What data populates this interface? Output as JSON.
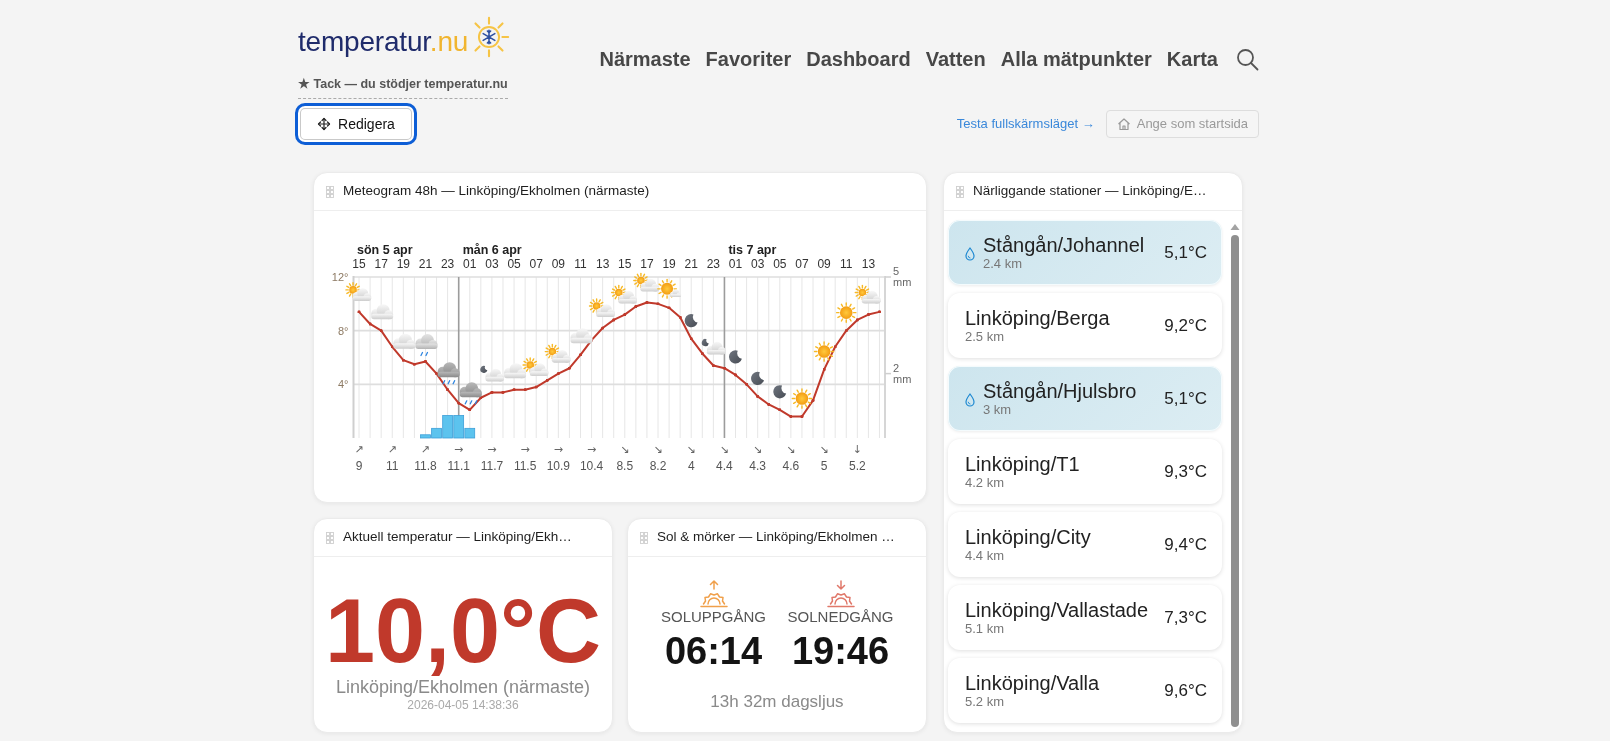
{
  "header": {
    "logo": {
      "name": "temperatur",
      "suffix": ".nu"
    },
    "thanks": "★ Tack — du stödjer temperatur.nu"
  },
  "nav": [
    {
      "label": "Närmaste",
      "selected": false
    },
    {
      "label": "Favoriter",
      "selected": false
    },
    {
      "label": "Dashboard",
      "selected": false
    },
    {
      "label": "Vatten",
      "selected": false
    },
    {
      "label": "Alla mätpunkter",
      "selected": false
    },
    {
      "label": "Karta",
      "selected": false
    }
  ],
  "toolbar": {
    "edit_button": {
      "label": "Redigera",
      "focused": true
    },
    "fullscreen_link": "Testa fullskärmsläget →",
    "start_button": {
      "label": "Ange som startsida",
      "disabled": true
    }
  },
  "meteogram": {
    "title": "Meteogram 48h — Linköping/Ekholmen (närmaste)",
    "temperature": {
      "chart_data": {
        "type": "line",
        "grid": true,
        "categories": [
          "15",
          null,
          "17",
          null,
          "19",
          null,
          "21",
          null,
          "23",
          null,
          "01",
          null,
          "03",
          null,
          "05",
          null,
          "07",
          null,
          "09",
          null,
          "11",
          null,
          "13",
          null,
          "15",
          null,
          "17",
          null,
          "19",
          null,
          "21",
          null,
          "23",
          null,
          "01",
          null,
          "03",
          null,
          "05",
          null,
          "07",
          null,
          "09",
          null,
          "11",
          null,
          "13",
          null
        ],
        "ylim": [
          0,
          12
        ],
        "yticks": [
          {
            "value": 4,
            "label": "4°"
          },
          {
            "value": 8,
            "label": "8°"
          },
          {
            "value": 12,
            "label": "12°"
          }
        ],
        "series": [
          {
            "color": "#c0392b",
            "values": [
              9.4,
              8.5,
              8.0,
              6.8,
              5.8,
              5.5,
              5.7,
              4.8,
              3.6,
              2.6,
              2.1,
              3.0,
              3.4,
              3.4,
              3.6,
              3.6,
              3.8,
              4.3,
              4.8,
              5.2,
              6.2,
              7.3,
              8.2,
              8.8,
              9.2,
              9.8,
              10.1,
              10.0,
              9.7,
              9.0,
              7.4,
              6.3,
              5.4,
              5.2,
              4.7,
              4.0,
              3.1,
              2.5,
              2.1,
              1.6,
              1.6,
              2.8,
              5.1,
              6.8,
              8.0,
              8.8,
              9.2,
              9.4
            ]
          }
        ],
        "annotations": [
          "sön 5 apr",
          "mån 6 apr",
          "tis 7 apr"
        ]
      }
    },
    "precipitation": {
      "chart_data": {
        "type": "bar",
        "categories": [
          null,
          null,
          null,
          null,
          null,
          null,
          null,
          null,
          null,
          null,
          null,
          null,
          null,
          null,
          null,
          null,
          null,
          null,
          null,
          null,
          null,
          null,
          null,
          null,
          null,
          null,
          null,
          null,
          null,
          null,
          null,
          null,
          null,
          null,
          null,
          null,
          null,
          null,
          null,
          null,
          null,
          null,
          null,
          null,
          null,
          null,
          null,
          null
        ],
        "ylim": [
          0,
          5
        ],
        "yticks": [
          {
            "value": 2,
            "label": "2 mm"
          },
          {
            "value": 5,
            "label": "5 mm"
          }
        ],
        "series": [
          {
            "color": "#5cc3ee",
            "values": [
              null,
              null,
              null,
              null,
              null,
              null,
              0.1,
              0.3,
              0.7,
              0.7,
              0.3,
              null,
              null,
              null,
              null,
              null,
              null,
              null,
              null,
              null,
              null,
              null,
              null,
              null,
              null,
              null,
              null,
              null,
              null,
              null,
              null,
              null,
              null,
              null,
              null,
              null,
              null,
              null,
              null,
              null,
              null,
              null,
              null,
              null,
              null,
              null,
              null,
              null
            ]
          }
        ]
      }
    },
    "wind": [
      {
        "arrow": "↗",
        "speed": "9"
      },
      {
        "arrow": "↗",
        "speed": "11"
      },
      {
        "arrow": "↗",
        "speed": "11.8"
      },
      {
        "arrow": "→",
        "speed": "11.1"
      },
      {
        "arrow": "→",
        "speed": "11.7"
      },
      {
        "arrow": "→",
        "speed": "11.5"
      },
      {
        "arrow": "→",
        "speed": "10.9"
      },
      {
        "arrow": "→",
        "speed": "10.4"
      },
      {
        "arrow": "↘",
        "speed": "8.5"
      },
      {
        "arrow": "↘",
        "speed": "8.2"
      },
      {
        "arrow": "↘",
        "speed": "4"
      },
      {
        "arrow": "↘",
        "speed": "4.4"
      },
      {
        "arrow": "↘",
        "speed": "4.3"
      },
      {
        "arrow": "↘",
        "speed": "4.6"
      },
      {
        "arrow": "↘",
        "speed": "5"
      },
      {
        "arrow": "↓",
        "speed": "5.2"
      }
    ]
  },
  "current": {
    "title": "Aktuell temperatur — Linköping/Ekh…",
    "temperature": "10,0°C",
    "station": "Linköping/Ekholmen (närmaste)",
    "timestamp": "2026-04-05 14:38:36"
  },
  "sun": {
    "title": "Sol & mörker — Linköping/Ekholmen …",
    "sunrise": {
      "label": "SOLUPPGÅNG",
      "time": "06:14"
    },
    "sunset": {
      "label": "SOLNEDGÅNG",
      "time": "19:46"
    },
    "daylight": "13h 32m dagsljus"
  },
  "nearby": {
    "title": "Närliggande stationer — Linköping/E…",
    "stations": [
      {
        "kind": "water",
        "name": "Stångån/Johannel",
        "distance": "2.4 km",
        "temperature": "5,1°C"
      },
      {
        "kind": "air",
        "name": "Linköping/Berga",
        "distance": "2.5 km",
        "temperature": "9,2°C"
      },
      {
        "kind": "water",
        "name": "Stångån/Hjulsbro",
        "distance": "3 km",
        "temperature": "5,1°C"
      },
      {
        "kind": "air",
        "name": "Linköping/T1",
        "distance": "4.2 km",
        "temperature": "9,3°C"
      },
      {
        "kind": "air",
        "name": "Linköping/City",
        "distance": "4.4 km",
        "temperature": "9,4°C"
      },
      {
        "kind": "air",
        "name": "Linköping/Vallastade",
        "distance": "5.1 km",
        "temperature": "7,3°C"
      },
      {
        "kind": "air",
        "name": "Linköping/Valla",
        "distance": "5.2 km",
        "temperature": "9,6°C"
      }
    ]
  }
}
